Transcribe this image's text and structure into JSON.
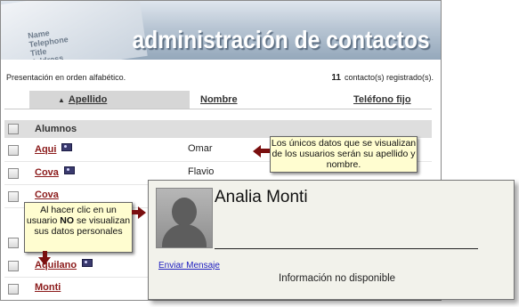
{
  "header": {
    "title": "administración de contactos",
    "bg_text": [
      "Name",
      "Telephone",
      "Title",
      "Address"
    ]
  },
  "summary": {
    "order_text": "Presentación en orden alfabético.",
    "count": "11",
    "count_suffix": "contacto(s) registrado(s)."
  },
  "table": {
    "columns": [
      "Apellido",
      "Nombre",
      "Teléfono fijo"
    ],
    "sorted_column": "Apellido",
    "group_label": "Alumnos",
    "rows": [
      {
        "surname": "Aqui",
        "name": "Omar",
        "has_card": true
      },
      {
        "surname": "Cova",
        "name": "Flavio",
        "has_card": true
      },
      {
        "surname": "Cova",
        "name": "",
        "has_card": false
      },
      {
        "surname": "Aquilano",
        "name": "",
        "has_card": true
      },
      {
        "surname": "Monti",
        "name": "",
        "has_card": false
      }
    ]
  },
  "tooltips": {
    "right": "Los únicos datos que se visualizan de los usuarios serán su apellido y nombre.",
    "left_pre": "Al hacer clic en un usuario",
    "left_bold": "NO",
    "left_post": "se visualizan sus datos personales"
  },
  "popup": {
    "name": "Analia Monti",
    "send_message": "Enviar Mensaje",
    "no_info": "Información no disponible"
  },
  "colors": {
    "link": "#8b1a1a",
    "arrow": "#7a0f0f",
    "tooltip_bg": "#fffdd0",
    "popup_bg": "#f2f2eb"
  }
}
